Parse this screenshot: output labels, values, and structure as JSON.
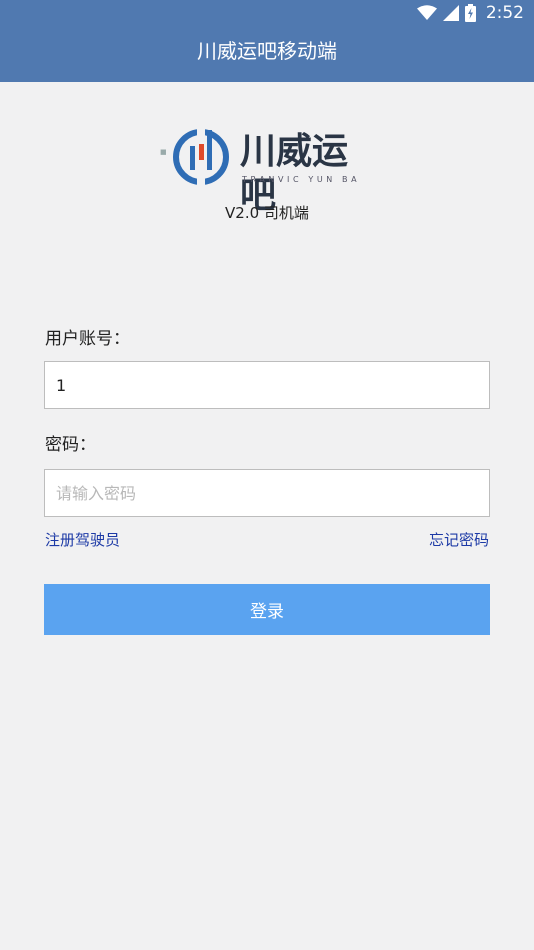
{
  "status_bar": {
    "time": "2:52",
    "icons": [
      "wifi-icon",
      "cell-signal-icon",
      "battery-charging-icon"
    ]
  },
  "app_bar": {
    "title": "川威运吧移动端"
  },
  "logo": {
    "brand_text": "川威运吧",
    "brand_sub": "TRANVIC YUN BA",
    "colors": {
      "ring": "#2f6db5",
      "accent": "#e04a2a",
      "text": "#2a3545"
    }
  },
  "version_text": "V2.0 司机端",
  "form": {
    "username_label": "用户账号：",
    "username_value": "1",
    "password_label": "密码：",
    "password_placeholder": "请输入密码",
    "register_link": "注册驾驶员",
    "forgot_link": "忘记密码",
    "login_button": "登录"
  },
  "colors": {
    "app_bar": "#5079b0",
    "background": "#f1f1f2",
    "button": "#5aa3f0",
    "link": "#1d3aa6"
  }
}
